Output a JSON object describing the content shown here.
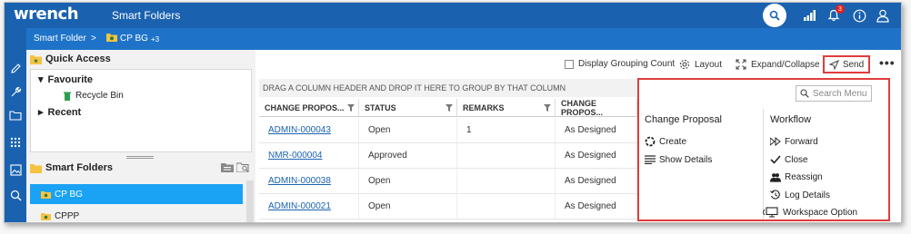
{
  "topbar": {
    "logo": "wrench",
    "title": "Smart Folders",
    "notification_count": "3"
  },
  "breadcrumb": {
    "expand": "»",
    "root": "Smart Folder",
    "separator": ">",
    "current": "CP BG",
    "current_suffix": "+3"
  },
  "quick_access": {
    "title": "Quick Access",
    "items": [
      {
        "label": "Favourite",
        "expanded": true
      },
      {
        "label": "Recycle Bin"
      },
      {
        "label": "Recent",
        "expanded": false
      }
    ]
  },
  "smart_folders": {
    "title": "Smart Folders",
    "items": [
      {
        "label": "CP BG",
        "selected": true
      },
      {
        "label": "CPPP",
        "selected": false
      }
    ]
  },
  "toolbar": {
    "display_grouping_count": "Display Grouping Count",
    "layout": "Layout",
    "expand_collapse": "Expand/Collapse",
    "send": "Send",
    "more": "•••"
  },
  "grid": {
    "group_hint": "DRAG A COLUMN HEADER AND DROP IT HERE TO GROUP BY THAT COLUMN",
    "columns": [
      "CHANGE PROPOS...",
      "STATUS",
      "REMARKS",
      "CHANGE PROPOS..."
    ],
    "rows": [
      [
        "ADMIN-000043",
        "Open",
        "1",
        "As Designed"
      ],
      [
        "NMR-000004",
        "Approved",
        "",
        "As Designed"
      ],
      [
        "ADMIN-000038",
        "Open",
        "",
        "As Designed"
      ],
      [
        "ADMIN-000021",
        "Open",
        "",
        "As Designed"
      ]
    ]
  },
  "send_menu": {
    "search_placeholder": "Search Menu",
    "change_proposal": {
      "title": "Change Proposal",
      "items": [
        "Create",
        "Show Details"
      ]
    },
    "workflow": {
      "title": "Workflow",
      "items": [
        "Forward",
        "Close",
        "Reassign",
        "Log Details",
        "Workspace Option"
      ]
    }
  },
  "colors": {
    "topbar": "#1a62b0",
    "crumbbar": "#1e73c8",
    "selected": "#1aa3f5",
    "highlight_border": "#e03c3c",
    "link": "#1a62b0"
  }
}
